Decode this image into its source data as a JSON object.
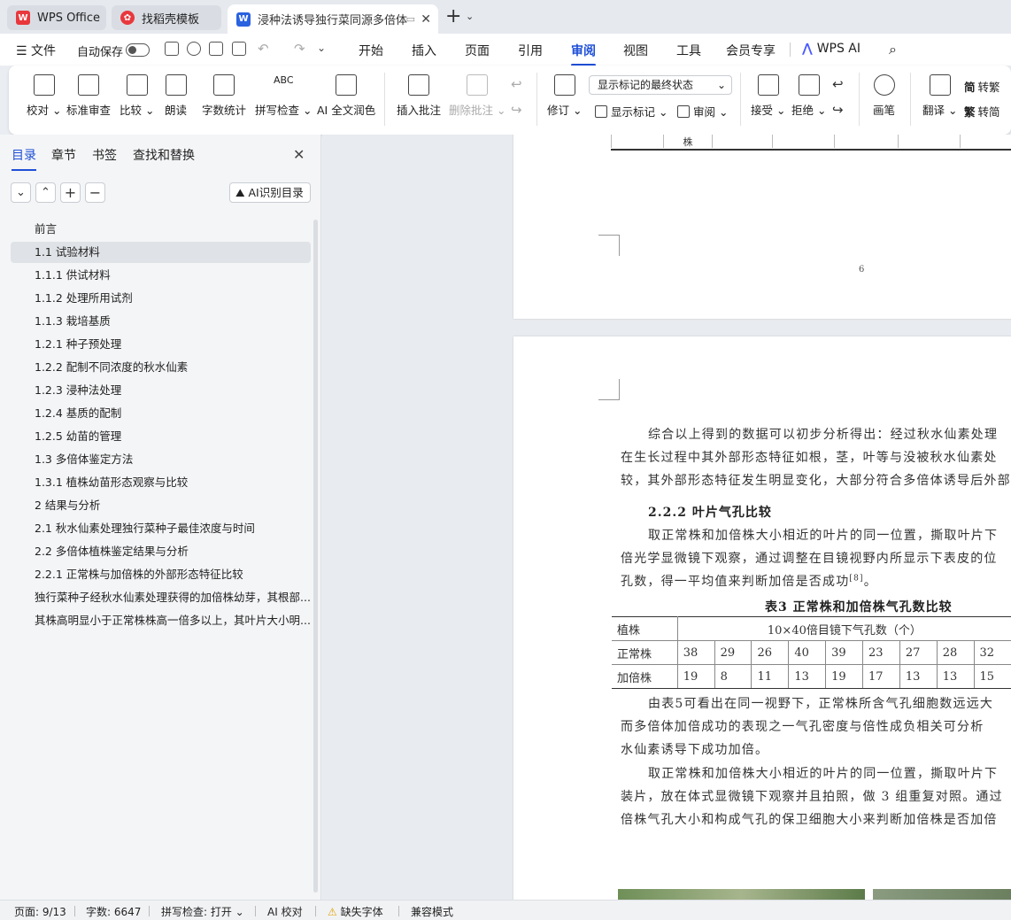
{
  "titlebar": {
    "tabs": [
      {
        "label": "WPS Office"
      },
      {
        "label": "找稻壳模板"
      },
      {
        "label": "浸种法诱导独行菜同源多倍体"
      }
    ],
    "new_tab": "+"
  },
  "menubar": {
    "file": "文件",
    "autosave": "自动保存",
    "items": [
      "开始",
      "插入",
      "页面",
      "引用",
      "审阅",
      "视图",
      "工具",
      "会员专享"
    ],
    "active": "审阅",
    "wps_ai": "WPS AI"
  },
  "ribbon": {
    "proof": "校对",
    "standard_review": "标准审查",
    "compare": "比较",
    "read_aloud": "朗读",
    "word_count": "字数统计",
    "spell_check": "拼写检查",
    "ai_polish": "AI 全文润色",
    "insert_comment": "插入批注",
    "delete_comment": "删除批注",
    "revise": "修订",
    "display_mode": "显示标记的最终状态",
    "show_markup": "显示标记",
    "review": "审阅",
    "accept": "接受",
    "reject": "拒绝",
    "pen": "画笔",
    "translate": "翻译",
    "to_traditional": "转繁",
    "to_simplified": "转简"
  },
  "nav": {
    "tabs": [
      "目录",
      "章节",
      "书签",
      "查找和替换"
    ],
    "ai_toc": "AI识别目录",
    "items": [
      "前言",
      "1.1  试验材料",
      "1.1.1  供试材料",
      "1.1.2  处理所用试剂",
      "1.1.3  栽培基质",
      "1.2.1  种子预处理",
      "1.2.2  配制不同浓度的秋水仙素",
      "1.2.3  浸种法处理",
      "1.2.4  基质的配制",
      "1.2.5  幼苗的管理",
      "1.3  多倍体鉴定方法",
      "1.3.1  植株幼苗形态观察与比较",
      "2 结果与分析",
      "2.1  秋水仙素处理独行菜种子最佳浓度与时间",
      "2.2  多倍体植株鉴定结果与分析",
      "2.2.1  正常株与加倍株的外部形态特征比较",
      "独行菜种子经秋水仙素处理获得的加倍株幼芽，其根部...",
      "其株高明显小于正常株株高一倍多以上，其叶片大小明..."
    ],
    "selected_index": 1
  },
  "document": {
    "prev_table_cell": "株",
    "page_number": "6",
    "para1": [
      "综合以上得到的数据可以初步分析得出：经过秋水仙素处理",
      "在生长过程中其外部形态特征如根，茎，叶等与没被秋水仙素处",
      "较，其外部形态特征发生明显变化，大部分符合多倍体诱导后外部"
    ],
    "heading": "2.2.2  叶片气孔比较",
    "para2": [
      "取正常株和加倍株大小相近的叶片的同一位置，撕取叶片下",
      "倍光学显微镜下观察，通过调整在目镜视野内所显示下表皮的位",
      "孔数，得一平均值来判断加倍是否成功"
    ],
    "para2_ref": "[8]",
    "para2_end": "。",
    "table_caption": "表3  正常株和加倍株气孔数比较",
    "table": {
      "col0_header": "植株",
      "header_span": "10×40倍目镜下气孔数（个）",
      "rows": [
        {
          "label": "正常株",
          "values": [
            "38",
            "29",
            "26",
            "40",
            "39",
            "23",
            "27",
            "28",
            "32"
          ]
        },
        {
          "label": "加倍株",
          "values": [
            "19",
            "8",
            "11",
            "13",
            "19",
            "17",
            "13",
            "13",
            "15"
          ]
        }
      ]
    },
    "para3": [
      "由表5可看出在同一视野下，正常株所含气孔细胞数远远大",
      "而多倍体加倍成功的表现之一气孔密度与倍性成负相关可分析",
      "水仙素诱导下成功加倍。"
    ],
    "para4": [
      "取正常株和加倍株大小相近的叶片的同一位置，撕取叶片下",
      "装片，放在体式显微镜下观察并且拍照，做 3 组重复对照。通过",
      "倍株气孔大小和构成气孔的保卫细胞大小来判断加倍株是否加倍"
    ]
  },
  "statusbar": {
    "page": "页面: 9/13",
    "words": "字数: 6647",
    "spell": "拼写检查: 打开",
    "ai_proof": "AI 校对",
    "missing_font": "缺失字体",
    "compat": "兼容模式"
  },
  "colors": {
    "accent": "#1f4fd6",
    "wps_red": "#e8383d"
  }
}
